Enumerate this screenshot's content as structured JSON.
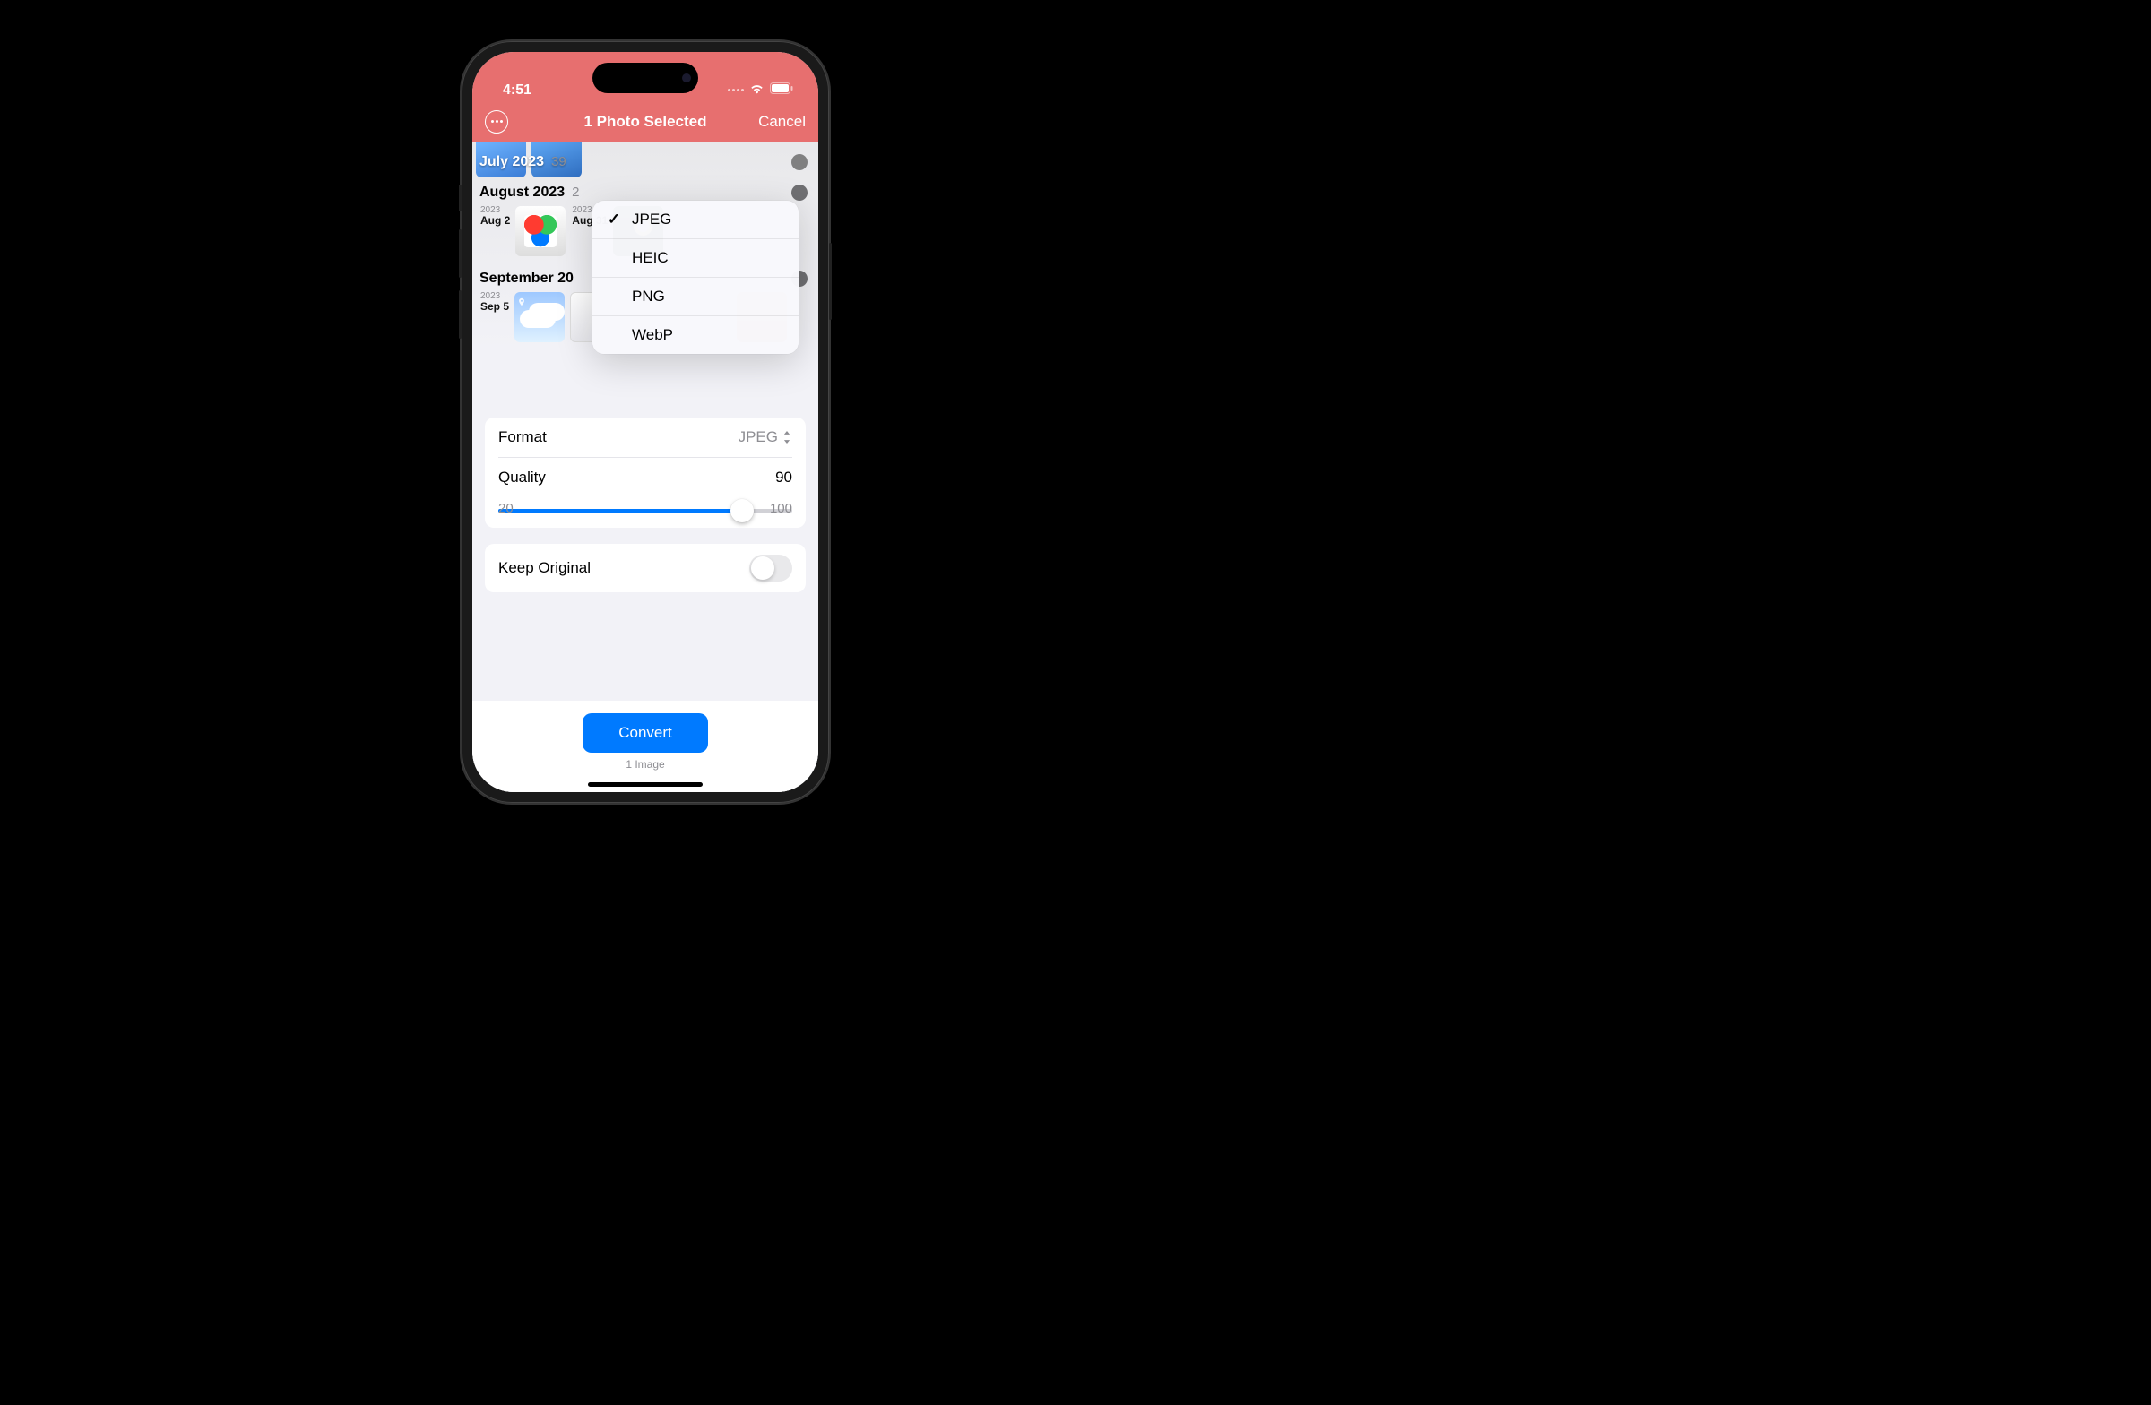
{
  "status": {
    "time": "4:51"
  },
  "nav": {
    "title": "1 Photo Selected",
    "cancel": "Cancel"
  },
  "sections": [
    {
      "title": "July 2023",
      "count": "39"
    },
    {
      "title": "August 2023",
      "count": "2",
      "photos": [
        {
          "year": "2023",
          "day": "Aug 2"
        },
        {
          "year": "2023",
          "day": "Aug 31"
        }
      ]
    },
    {
      "title": "September 20",
      "photos": [
        {
          "year": "2023",
          "day": "Sep 5"
        }
      ]
    }
  ],
  "format": {
    "label": "Format",
    "value": "JPEG",
    "options": [
      "JPEG",
      "HEIC",
      "PNG",
      "WebP"
    ],
    "selected_index": 0
  },
  "quality": {
    "label": "Quality",
    "value": "90",
    "min": "20",
    "max": "100"
  },
  "keep_original": {
    "label": "Keep Original",
    "on": false
  },
  "action": {
    "button": "Convert",
    "subtitle": "1 Image"
  }
}
